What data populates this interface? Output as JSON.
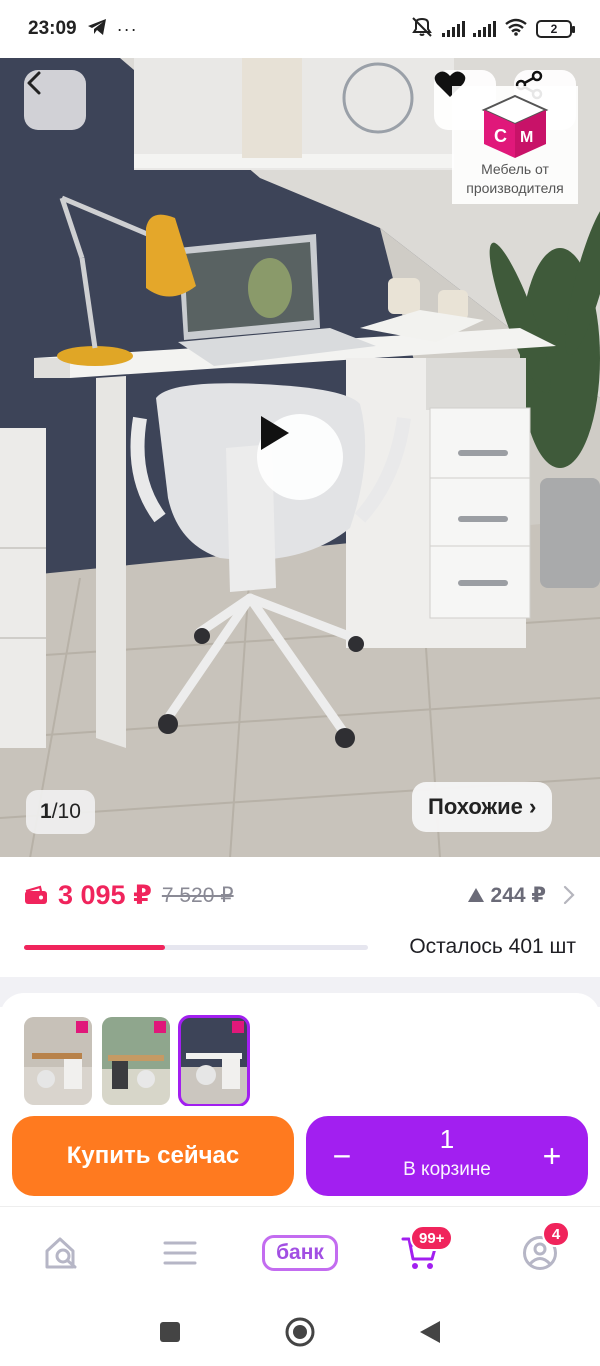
{
  "status_bar": {
    "time": "23:09",
    "more": "···",
    "battery": "2"
  },
  "gallery": {
    "counter_current": "1",
    "counter_sep": "/",
    "counter_total": "10",
    "similar_label": "Похожие ›",
    "brand_caption": "Мебель от производителя"
  },
  "price": {
    "current": "3 095 ₽",
    "old": "7 520 ₽",
    "diff": "244 ₽",
    "remaining": "Осталось 401 шт",
    "stock_progress": 0.41
  },
  "thumbnails": {
    "count": 3,
    "active_index": 2
  },
  "actions": {
    "buy_now": "Купить сейчас",
    "quantity": "1",
    "in_cart": "В корзине",
    "minus": "−",
    "plus": "+"
  },
  "bottom_nav": {
    "bank_label": "банк",
    "cart_badge": "99+",
    "profile_badge": "4"
  },
  "colors": {
    "accent_pink": "#f0245c",
    "buy_orange": "#ff7a1f",
    "cart_purple": "#a21ff0"
  }
}
